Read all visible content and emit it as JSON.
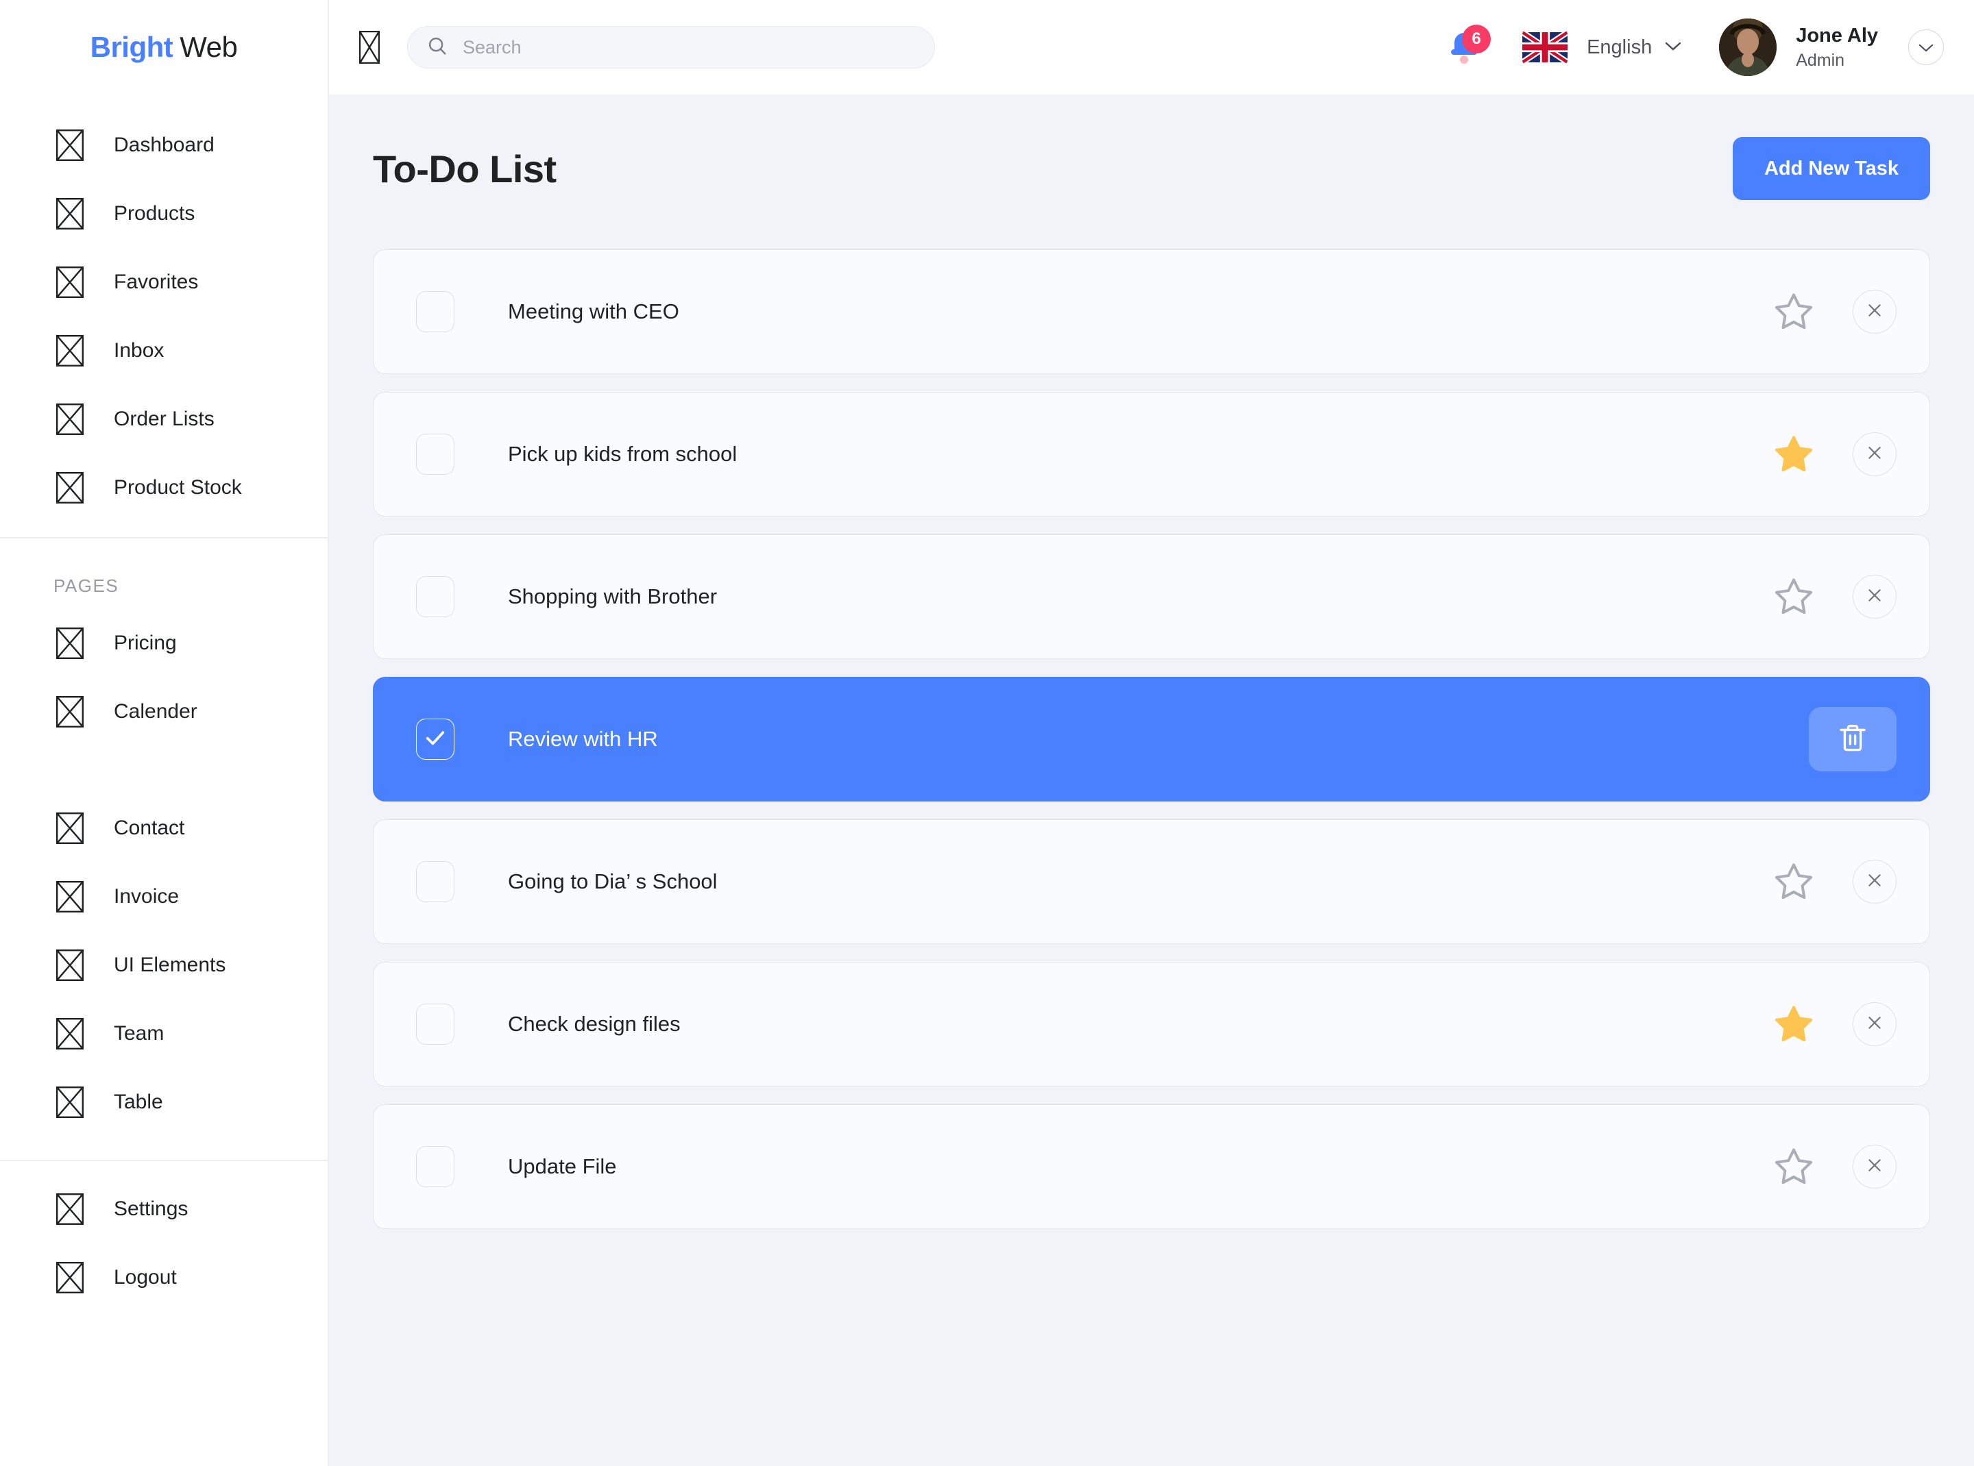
{
  "brand": {
    "part1": "Bright",
    "part2": "Web"
  },
  "sidebar": {
    "main_items": [
      {
        "label": "Dashboard",
        "icon": "broken-image-icon"
      },
      {
        "label": "Products",
        "icon": "broken-image-icon"
      },
      {
        "label": "Favorites",
        "icon": "broken-image-icon"
      },
      {
        "label": "Inbox",
        "icon": "broken-image-icon"
      },
      {
        "label": "Order Lists",
        "icon": "broken-image-icon"
      },
      {
        "label": "Product Stock",
        "icon": "broken-image-icon"
      }
    ],
    "section_title": "PAGES",
    "pages_items": [
      {
        "label": "Pricing",
        "icon": "broken-image-icon"
      },
      {
        "label": "Calender",
        "icon": "broken-image-icon"
      }
    ],
    "secondary_items": [
      {
        "label": "Contact",
        "icon": "broken-image-icon"
      },
      {
        "label": "Invoice",
        "icon": "broken-image-icon"
      },
      {
        "label": "UI Elements",
        "icon": "broken-image-icon"
      },
      {
        "label": "Team",
        "icon": "broken-image-icon"
      },
      {
        "label": "Table",
        "icon": "broken-image-icon"
      }
    ],
    "footer_items": [
      {
        "label": "Settings",
        "icon": "broken-image-icon"
      },
      {
        "label": "Logout",
        "icon": "broken-image-icon"
      }
    ]
  },
  "topbar": {
    "menu_icon": "broken-image-icon",
    "search": {
      "value": "",
      "placeholder": "Search",
      "icon": "search-icon"
    },
    "notifications": {
      "icon": "bell-icon",
      "count": "6"
    },
    "language": {
      "flag": "uk-flag-icon",
      "label": "English",
      "chevron": "chevron-down-icon"
    },
    "user": {
      "name": "Jone Aly",
      "role": "Admin",
      "avatar": "user-avatar",
      "chevron": "chevron-down-icon"
    }
  },
  "page": {
    "title": "To-Do List",
    "add_button": "Add New Task"
  },
  "tasks": [
    {
      "label": "Meeting with CEO",
      "checked": false,
      "starred": false,
      "selected": false
    },
    {
      "label": "Pick up kids from school",
      "checked": false,
      "starred": true,
      "selected": false
    },
    {
      "label": "Shopping with Brother",
      "checked": false,
      "starred": false,
      "selected": false
    },
    {
      "label": "Review with HR",
      "checked": true,
      "starred": false,
      "selected": true
    },
    {
      "label": "Going to Dia’ s School",
      "checked": false,
      "starred": false,
      "selected": false
    },
    {
      "label": "Check design files",
      "checked": false,
      "starred": true,
      "selected": false
    },
    {
      "label": "Update File",
      "checked": false,
      "starred": false,
      "selected": false
    }
  ],
  "colors": {
    "accent": "#4880ff",
    "badge": "#f93c65",
    "star_filled": "#fdc550",
    "content_bg": "#f1f3f8",
    "row_bg": "#fafbfe",
    "text": "#202224"
  }
}
